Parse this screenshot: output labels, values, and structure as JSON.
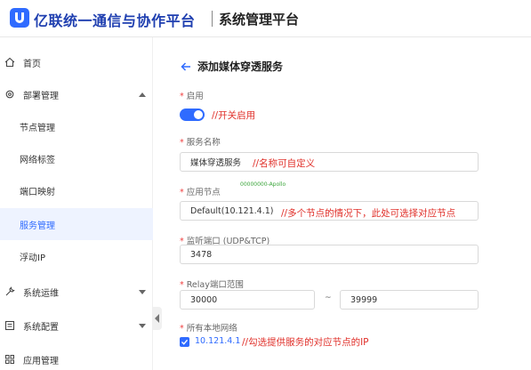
{
  "header": {
    "brand": "亿联统一通信与协作平台",
    "system_title": "系统管理平台"
  },
  "sidebar": {
    "items": [
      {
        "label": "首页",
        "icon": "home-icon"
      },
      {
        "label": "部署管理",
        "icon": "gear-icon",
        "expanded": true
      },
      {
        "label": "系统运维",
        "icon": "wrench-icon",
        "expanded": false
      },
      {
        "label": "系统配置",
        "icon": "list-icon",
        "expanded": false
      },
      {
        "label": "应用管理",
        "icon": "grid-icon"
      }
    ],
    "sub_items": [
      {
        "label": "节点管理"
      },
      {
        "label": "网络标签"
      },
      {
        "label": "端口映射"
      },
      {
        "label": "服务管理",
        "active": true
      },
      {
        "label": "浮动IP"
      }
    ]
  },
  "main": {
    "title": "添加媒体穿透服务",
    "enable": {
      "label": "启用",
      "on": true,
      "annotation": "//开关启用"
    },
    "service_name": {
      "label": "服务名称",
      "value": "媒体穿透服务",
      "annotation": "//名称可自定义"
    },
    "app_node": {
      "label": "应用节点",
      "value": "Default(10.121.4.1)",
      "annotation": "//多个节点的情况下，此处可选择对应节点"
    },
    "watermark": "00000000-Apollo",
    "listen_port": {
      "label": "监听端口 (UDP&TCP)",
      "value": "3478"
    },
    "relay_range": {
      "label": "Relay端口范围",
      "start": "30000",
      "separator": "~",
      "end": "39999"
    },
    "local_networks": {
      "label": "所有本地网络",
      "checked": true,
      "ip": "10.121.4.1",
      "annotation": "//勾选提供服务的对应节点的IP"
    }
  },
  "colors": {
    "accent": "#2f6bff",
    "annotation": "#e0302a",
    "active_bg": "#eef3ff"
  }
}
